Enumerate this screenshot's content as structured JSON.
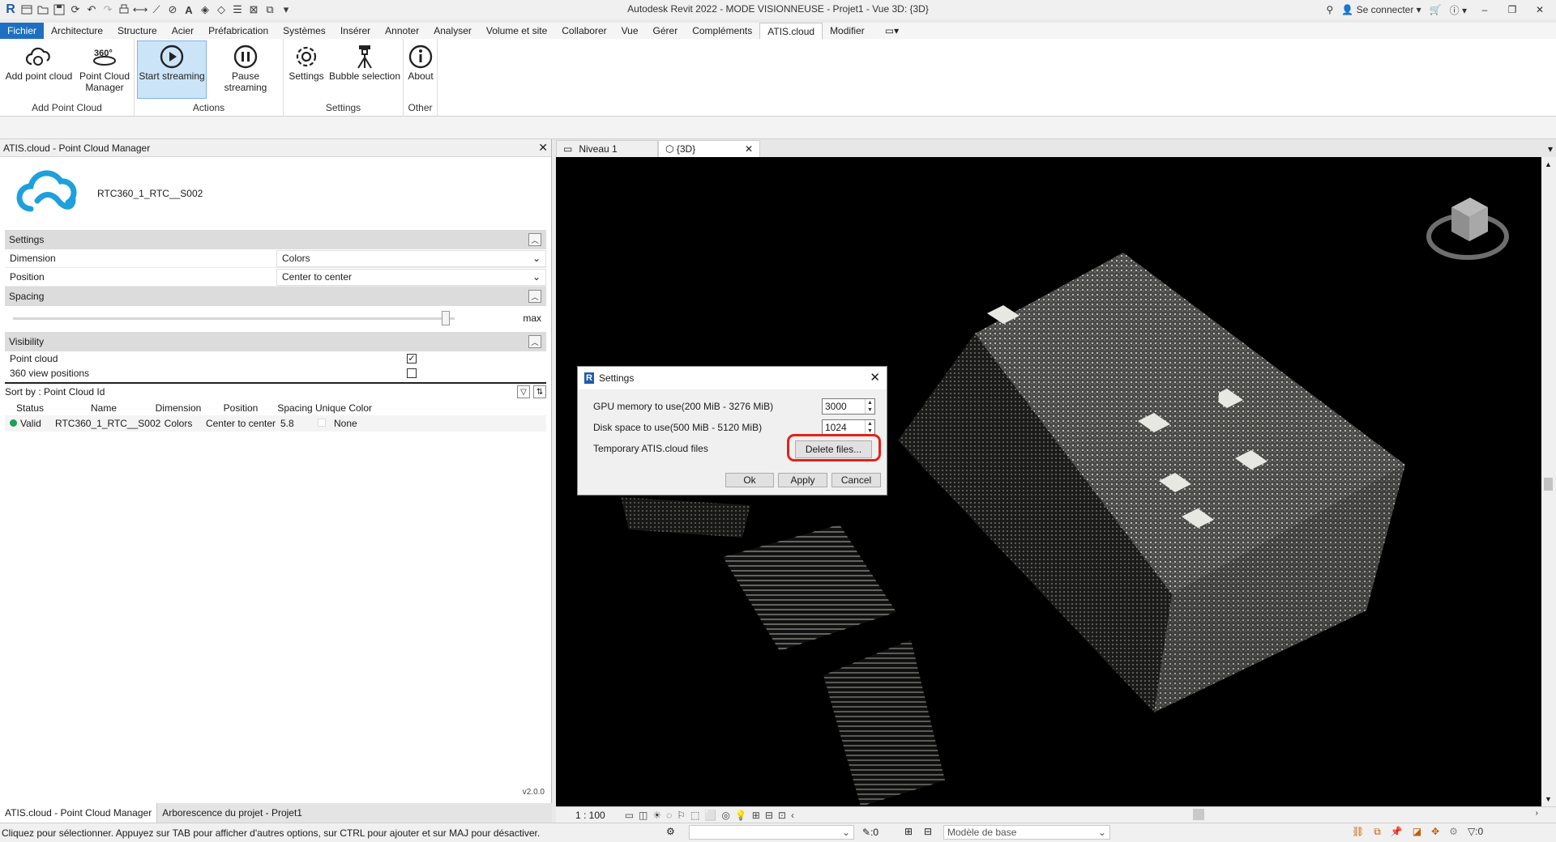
{
  "app": {
    "title": "Autodesk Revit 2022 - MODE VISIONNEUSE - Projet1 - Vue 3D: {3D}",
    "sign_in": "Se connecter"
  },
  "menu": {
    "tabs": [
      "Fichier",
      "Architecture",
      "Structure",
      "Acier",
      "Préfabrication",
      "Systèmes",
      "Insérer",
      "Annoter",
      "Analyser",
      "Volume et site",
      "Collaborer",
      "Vue",
      "Gérer",
      "Compléments",
      "ATIS.cloud",
      "Modifier"
    ],
    "active": "ATIS.cloud"
  },
  "ribbon": {
    "groups": {
      "add": "Add Point Cloud",
      "actions": "Actions",
      "settings": "Settings",
      "other": "Other"
    },
    "buttons": {
      "add_point_cloud": "Add point cloud",
      "pcm_line1": "Point Cloud",
      "pcm_line2": "Manager",
      "start_streaming": "Start streaming",
      "pause_streaming": "Pause streaming",
      "settings": "Settings",
      "bubble_selection": "Bubble selection",
      "about": "About"
    }
  },
  "left_panel": {
    "title": "ATIS.cloud - Point Cloud Manager",
    "cloud_name": "RTC360_1_RTC__S002",
    "settings": {
      "header": "Settings",
      "dimension_label": "Dimension",
      "dimension_value": "Colors",
      "position_label": "Position",
      "position_value": "Center to center"
    },
    "spacing": {
      "header": "Spacing",
      "max_label": "max",
      "level": 0.98
    },
    "visibility": {
      "header": "Visibility",
      "point_cloud_label": "Point cloud",
      "point_cloud_checked": true,
      "view360_label": "360 view positions",
      "view360_checked": false
    },
    "sort_label": "Sort by : Point Cloud Id",
    "table": {
      "columns": [
        "Status",
        "Name",
        "Dimension",
        "Position",
        "Spacing",
        "Unique Color"
      ],
      "rows": [
        {
          "status": "Valid",
          "name": "RTC360_1_RTC__S002",
          "dimension": "Colors",
          "position": "Center to center",
          "spacing": "5.8",
          "unique_color": "None"
        }
      ]
    },
    "version": "v2.0.0",
    "bottom_tabs": [
      "ATIS.cloud - Point Cloud Manager",
      "Arborescence du projet - Projet1"
    ]
  },
  "view_tabs": [
    "Niveau 1",
    "{3D}"
  ],
  "view_status": {
    "scale": "1 : 100"
  },
  "statusbar": {
    "message": "Cliquez pour sélectionner. Appuyez sur TAB pour afficher d'autres options, sur CTRL pour ajouter et sur MAJ pour désactiver.",
    "count": ":0",
    "model": "Modèle de base",
    "filter_count": ":0"
  },
  "dialog": {
    "title": "Settings",
    "gpu_label": "GPU memory to use(200 MiB - 3276 MiB)",
    "gpu_value": "3000",
    "disk_label": "Disk space to use(500 MiB - 5120 MiB)",
    "disk_value": "1024",
    "temp_label": "Temporary ATIS.cloud files",
    "delete_button": "Delete files...",
    "ok": "Ok",
    "apply": "Apply",
    "cancel": "Cancel"
  },
  "colors": {
    "file_tab": "#1e6fc2",
    "cloud_logo": "#1ea0dc",
    "status_valid": "#1e9e5a",
    "highlight": "#e2231a",
    "pressed": "#cce4f7"
  }
}
